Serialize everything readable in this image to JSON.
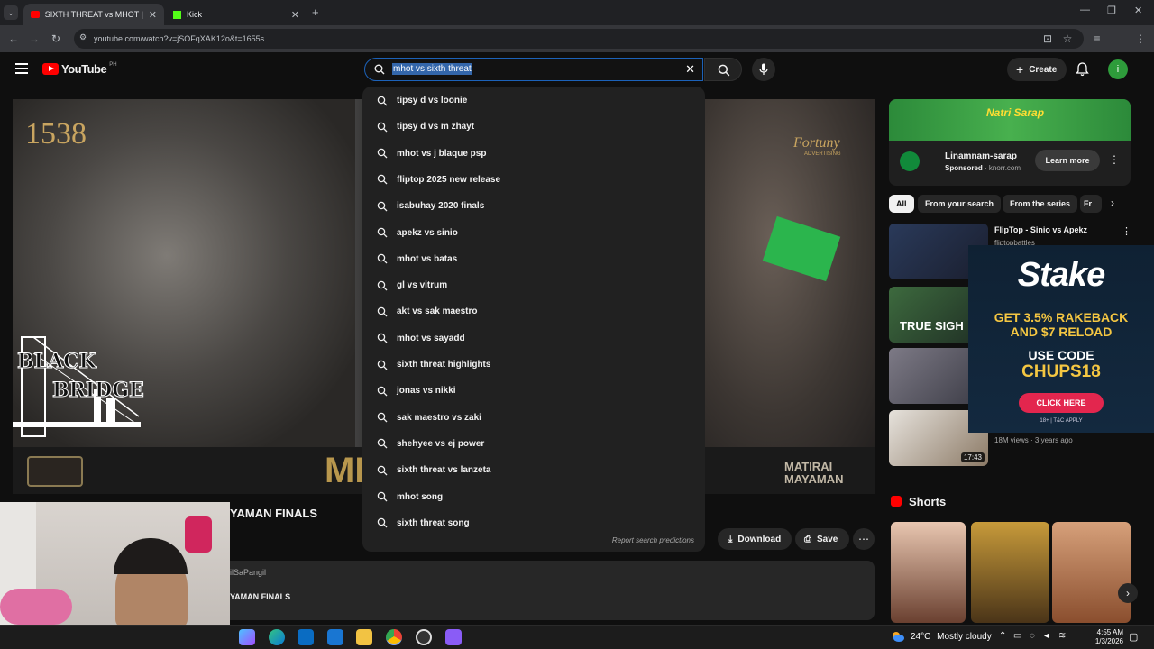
{
  "browser": {
    "tabs": [
      {
        "label": "SIXTH THREAT vs MHOT | MATI",
        "active": true
      },
      {
        "label": "Kick",
        "active": false
      }
    ],
    "url": "youtube.com/watch?v=jSOFqXAK12o&t=1655s"
  },
  "youtube": {
    "logo_text": "YouTube",
    "region": "PH",
    "search_value": "mhot vs sixth threat",
    "create_label": "Create",
    "avatar_letter": "i"
  },
  "suggestions": [
    "tipsy d vs loonie",
    "tipsy d vs m zhayt",
    "mhot vs j blaque psp",
    "fliptop 2025 new release",
    "isabuhay 2020 finals",
    "apekz vs sinio",
    "mhot vs batas",
    "gl vs vitrum",
    "akt vs sak maestro",
    "mhot vs sayadd",
    "sixth threat highlights",
    "jonas vs nikki",
    "sak maestro vs zaki",
    "shehyee vs ej power",
    "sixth threat vs lanzeta",
    "mhot song",
    "sixth threat song"
  ],
  "report_text": "Report search predictions",
  "video": {
    "title_partial": "YAMAN FINALS",
    "channel_partial": "ilSaPangil",
    "desc_partial": "YAMAN FINALS",
    "overlay_left_top": "1538",
    "overlay_right_top": "Fortuny",
    "overlay_right_sub": "ADVERTISING",
    "logo_black": "BLACK",
    "logo_bridge": "BRIDGE",
    "bottom_mid": "MH",
    "bottom_right_1": "MATIRAI",
    "bottom_right_2": "MAYAMAN",
    "download_label": "Download",
    "save_label": "Save"
  },
  "ad": {
    "brand_banner": "Natri Sarap",
    "name": "Linamnam-sarap",
    "sponsored": "Sponsored",
    "domain": "knorr.com",
    "cta": "Learn more"
  },
  "filters": [
    "All",
    "From your search",
    "From the series",
    "Fr"
  ],
  "related": [
    {
      "title": "FlipTop - Sinio vs Apekz",
      "channel": "fliptopbattles",
      "thumb_text": ""
    },
    {
      "title": "",
      "channel": "",
      "thumb_text": "TRUE SIGH"
    },
    {
      "title": "",
      "channel": "",
      "thumb_text": ""
    },
    {
      "title": "",
      "channel": "",
      "meta": "18M views · 3 years ago",
      "duration": "17:43"
    }
  ],
  "stake": {
    "logo": "Stake",
    "line1": "GET 3.5% RAKEBACK",
    "line2": "AND $7 RELOAD",
    "line3": "USE CODE",
    "code": "CHUPS18",
    "cta": "CLICK HERE",
    "fine": "18+ | T&C APPLY"
  },
  "shorts_label": "Shorts",
  "taskbar": {
    "temp": "24°C",
    "weather": "Mostly cloudy",
    "time": "4:55 AM",
    "date": "1/3/2026"
  },
  "colors": {
    "yt_red": "#ff0000",
    "stake_bg": "#0f2133",
    "stake_cta": "#e3264e",
    "code_color": "#f5c742",
    "avatar": "#2e9c3b"
  }
}
